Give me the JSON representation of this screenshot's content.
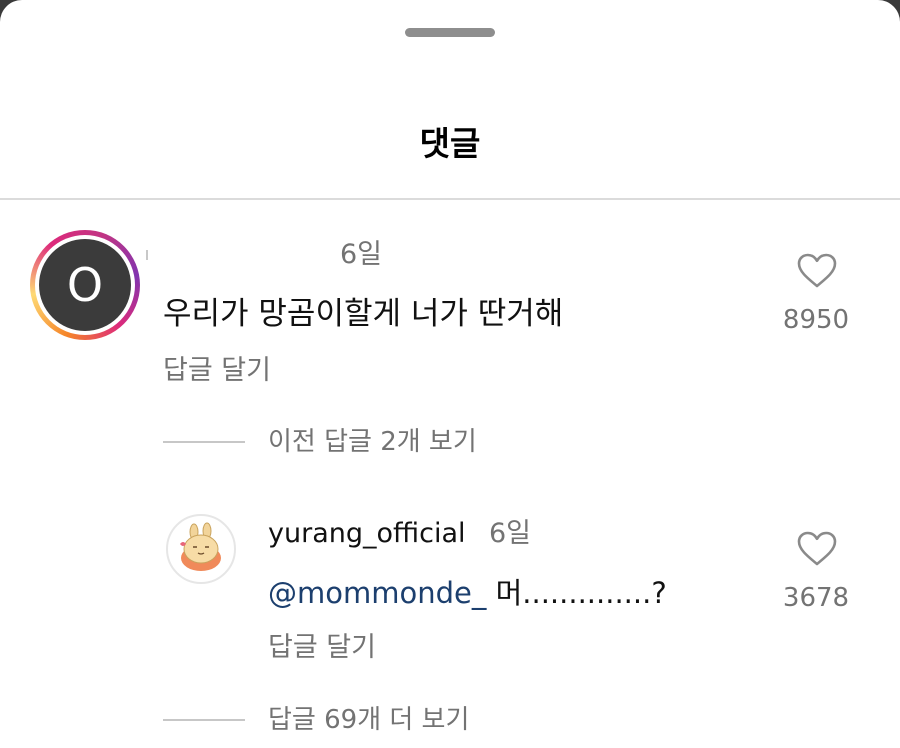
{
  "sheet": {
    "title": "댓글"
  },
  "comment": {
    "avatar_letter": "O",
    "time": "6일",
    "text": "우리가 망곰이할게 너가 딴거해",
    "reply_action": "답글 달기",
    "likes": "8950",
    "heart_icon": "heart-outline-icon"
  },
  "thread_prev": {
    "label": "이전 답글 2개 보기"
  },
  "reply": {
    "username": "yurang_official",
    "time": "6일",
    "mention": "@mommonde_",
    "text": " 머..............?",
    "reply_action": "답글 달기",
    "likes": "3678",
    "heart_icon": "heart-outline-icon"
  },
  "thread_more": {
    "label": "답글 69개 더 보기"
  },
  "colors": {
    "secondary_text": "#737373",
    "mention": "#1c3f6e",
    "divider": "#dbdbdb"
  }
}
